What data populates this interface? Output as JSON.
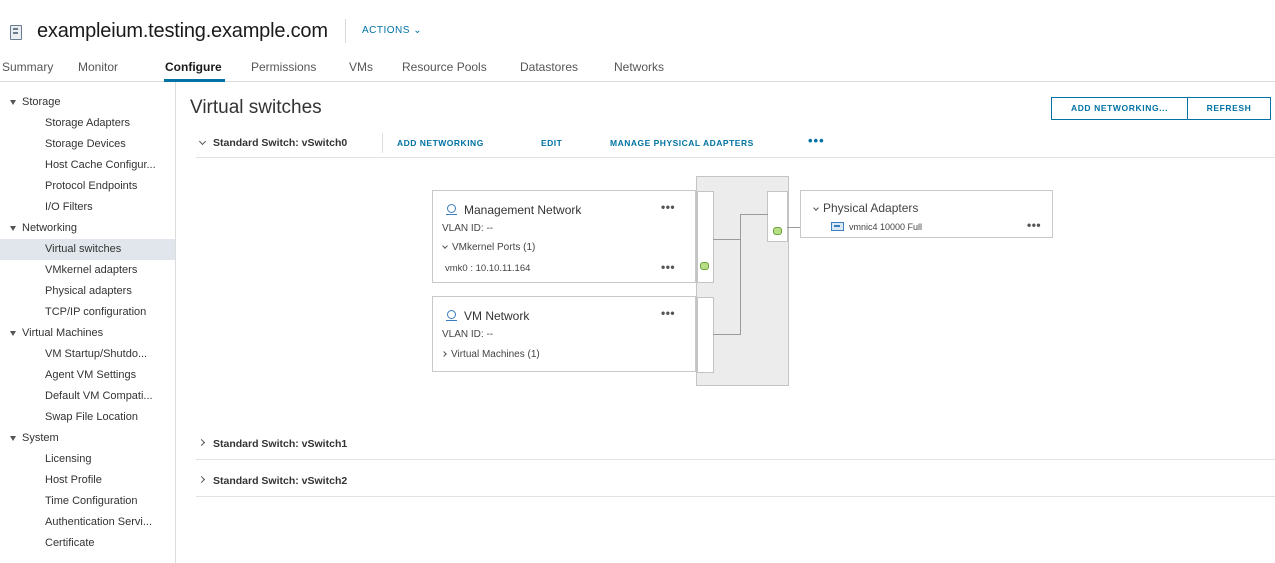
{
  "header": {
    "title": "exampleium.testing.example.com",
    "actions_label": "ACTIONS ⌄"
  },
  "tabs": [
    {
      "label": "Summary"
    },
    {
      "label": "Monitor"
    },
    {
      "label": "Configure",
      "active": true
    },
    {
      "label": "Permissions"
    },
    {
      "label": "VMs"
    },
    {
      "label": "Resource Pools"
    },
    {
      "label": "Datastores"
    },
    {
      "label": "Networks"
    }
  ],
  "sidebar": {
    "groups": [
      {
        "label": "Storage",
        "items": [
          "Storage Adapters",
          "Storage Devices",
          "Host Cache Configur...",
          "Protocol Endpoints",
          "I/O Filters"
        ]
      },
      {
        "label": "Networking",
        "items": [
          "Virtual switches",
          "VMkernel adapters",
          "Physical adapters",
          "TCP/IP configuration"
        ]
      },
      {
        "label": "Virtual Machines",
        "items": [
          "VM Startup/Shutdo...",
          "Agent VM Settings",
          "Default VM Compati...",
          "Swap File Location"
        ]
      },
      {
        "label": "System",
        "items": [
          "Licensing",
          "Host Profile",
          "Time Configuration",
          "Authentication Servi...",
          "Certificate"
        ]
      }
    ],
    "selected": "Virtual switches"
  },
  "main": {
    "title": "Virtual switches",
    "add_networking_button": "ADD NETWORKING...",
    "refresh_button": "REFRESH",
    "switch0": {
      "label": "Standard Switch: vSwitch0",
      "add_networking": "ADD NETWORKING",
      "edit": "EDIT",
      "manage_physical_adapters": "MANAGE PHYSICAL ADAPTERS",
      "more": "•••"
    },
    "switch1_label": "Standard Switch: vSwitch1",
    "switch2_label": "Standard Switch: vSwitch2"
  },
  "diagram": {
    "management_network": {
      "title": "Management Network",
      "vlan": "VLAN ID: --",
      "ports_label": "VMkernel Ports (1)",
      "vmk": "vmk0 : 10.10.11.164",
      "more": "•••",
      "vmk_more": "•••"
    },
    "vm_network": {
      "title": "VM Network",
      "vlan": "VLAN ID: --",
      "vms_label": "Virtual Machines (1)",
      "more": "•••"
    },
    "physical_adapters": {
      "title": "Physical Adapters",
      "nic": "vmnic4 10000 Full",
      "more": "•••"
    }
  },
  "colors": {
    "accent": "#0072a3",
    "selected_bg": "#e0e6ec",
    "port_green": "#b7dd87"
  }
}
